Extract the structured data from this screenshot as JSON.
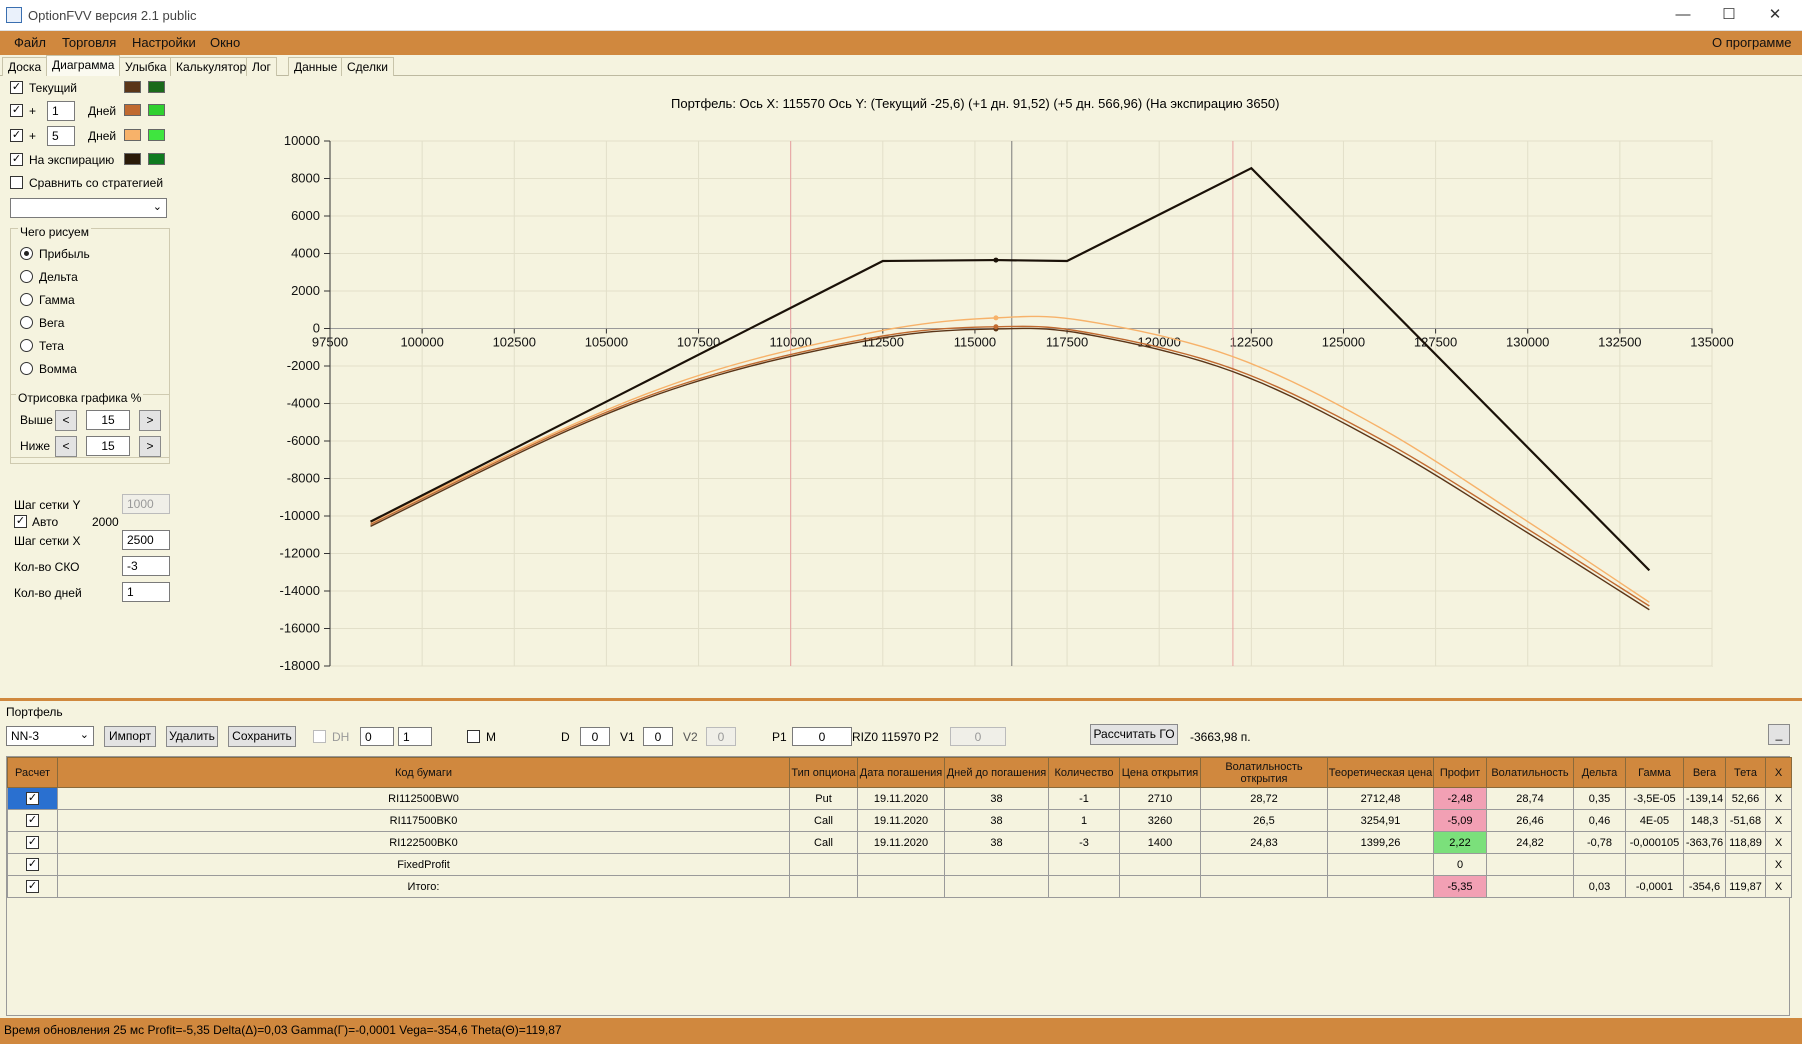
{
  "window": {
    "title": "OptionFVV версия 2.1 public",
    "minimize": "—",
    "maximize": "☐",
    "close": "✕"
  },
  "menu": {
    "items": [
      "Файл",
      "Торговля",
      "Настройки",
      "Окно"
    ],
    "about": "О программе"
  },
  "tabs": [
    "Доска",
    "Диаграмма",
    "Улыбка",
    "Калькулятор",
    "Лог",
    "Данные",
    "Сделки"
  ],
  "active_tab": "Диаграмма",
  "left_panel": {
    "current_label": "Текущий",
    "plus1_sign": "+",
    "plus1_value": "1",
    "plus1_unit": "Дней",
    "plus5_sign": "+",
    "plus5_value": "5",
    "plus5_unit": "Дней",
    "expiry_label": "На экспирацию",
    "compare_label": "Сравнить со стратегией",
    "colors": {
      "current": [
        "#5a3518",
        "#1a6a1a"
      ],
      "plus1": [
        "#c06a30",
        "#2fd02f"
      ],
      "plus5": [
        "#f7b26a",
        "#3fe53f"
      ],
      "expiry": [
        "#2a1a08",
        "#0f7a1f"
      ]
    },
    "draw_group_title": "Чего рисуем",
    "draw_options": [
      "Прибыль",
      "Дельта",
      "Гамма",
      "Вега",
      "Тета",
      "Вомма"
    ],
    "draw_selected": "Прибыль",
    "render_group_title": "Отрисовка графика %",
    "above_label": "Выше",
    "above_value": "15",
    "below_label": "Ниже",
    "below_value": "15",
    "dec": "<",
    "inc": ">",
    "grid_y_label": "Шаг сетки Y",
    "grid_y_value": "1000",
    "auto_label": "Авто",
    "auto_value": "2000",
    "grid_x_label": "Шаг сетки X",
    "grid_x_value": "2500",
    "sko_label": "Кол-во СКО",
    "sko_value": "-3",
    "days_label": "Кол-во дней",
    "days_value": "1"
  },
  "chart_title": "Портфель: Ось X: 115570 Ось Y:  (Текущий -25,6)  (+1 дн. 91,52)  (+5 дн. 566,96)  (На экспирацию 3650)",
  "chart_data": {
    "type": "line",
    "title": "Портфель: Ось X: 115570 Ось Y:  (Текущий -25,6)  (+1 дн. 91,52)  (+5 дн. 566,96)  (На экспирацию 3650)",
    "xlim": [
      97500,
      135000
    ],
    "ylim": [
      -18000,
      10000
    ],
    "x_ticks": [
      "97500",
      "100000",
      "102500",
      "105000",
      "107500",
      "110000",
      "112500",
      "115000",
      "117500",
      "120000",
      "122500",
      "125000",
      "127500",
      "130000",
      "132500",
      "135000"
    ],
    "y_ticks": [
      "10000",
      "8000",
      "6000",
      "4000",
      "2000",
      "0",
      "-2000",
      "-4000",
      "-6000",
      "-8000",
      "-10000",
      "-12000",
      "-14000",
      "-16000",
      "-18000"
    ],
    "current_x": 115570,
    "cursor_x": 116000,
    "vlines": [
      110000,
      122000
    ],
    "series": [
      {
        "color": "#1a1108",
        "x": [
          98600,
          112500,
          115570,
          117500,
          122500,
          133300
        ],
        "y": [
          -10300,
          3600,
          3650,
          3600,
          8550,
          -12900
        ]
      },
      {
        "color": "#5a3518",
        "x": [
          98600,
          104000,
          108000,
          112500,
          115570,
          118000,
          122000,
          126000,
          130000,
          133300
        ],
        "y": [
          -10550,
          -5400,
          -2500,
          -500,
          -25.6,
          -300,
          -2300,
          -6100,
          -10900,
          -15000
        ]
      },
      {
        "color": "#c06a30",
        "x": [
          98600,
          104000,
          108000,
          112500,
          115570,
          118000,
          122000,
          126000,
          130000,
          133300
        ],
        "y": [
          -10450,
          -5300,
          -2400,
          -400,
          91.52,
          -200,
          -2150,
          -5900,
          -10700,
          -14800
        ]
      },
      {
        "color": "#f7b26a",
        "x": [
          98600,
          104000,
          108000,
          112500,
          115570,
          118000,
          122000,
          126000,
          130000,
          133300
        ],
        "y": [
          -10350,
          -5200,
          -2200,
          -100,
          566.96,
          400,
          -1500,
          -5300,
          -10300,
          -14600
        ]
      }
    ]
  },
  "portfolio": {
    "label": "Портфель",
    "select_value": "NN-3",
    "import": "Импорт",
    "delete": "Удалить",
    "save": "Сохранить",
    "dh_label": "DH",
    "num1": "0",
    "num2": "1",
    "m_label": "M",
    "d_label": "D",
    "d_value": "0",
    "v1_label": "V1",
    "v1_value": "0",
    "v2_label": "V2",
    "v2_value": "0",
    "p1_label": "P1",
    "p1_value": "0",
    "riz_label": "RIZ0 115970",
    "p2_label": "P2",
    "p2_value": "0",
    "calc_go": "Рассчитать ГО",
    "go_value": "-3663,98 п.",
    "collapse": "_"
  },
  "table": {
    "headers": [
      "Расчет",
      "Код бумаги",
      "Тип опциона",
      "Дата погашения",
      "Дней до погашения",
      "Количество",
      "Цена открытия",
      "Волатильность открытия",
      "Теоретическая цена",
      "Профит",
      "Волатильность",
      "Дельта",
      "Гамма",
      "Вега",
      "Тета",
      "X"
    ],
    "rows": [
      [
        "RI112500BW0",
        "Put",
        "19.11.2020",
        "38",
        "-1",
        "2710",
        "28,72",
        "2712,48",
        "-2,48",
        "28,74",
        "0,35",
        "-3,5E-05",
        "-139,14",
        "52,66",
        "X"
      ],
      [
        "RI117500BK0",
        "Call",
        "19.11.2020",
        "38",
        "1",
        "3260",
        "26,5",
        "3254,91",
        "-5,09",
        "26,46",
        "0,46",
        "4E-05",
        "148,3",
        "-51,68",
        "X"
      ],
      [
        "RI122500BK0",
        "Call",
        "19.11.2020",
        "38",
        "-3",
        "1400",
        "24,83",
        "1399,26",
        "2,22",
        "24,82",
        "-0,78",
        "-0,000105",
        "-363,76",
        "118,89",
        "X"
      ],
      [
        "FixedProfit",
        "",
        "",
        "",
        "",
        "",
        "",
        "",
        "0",
        "",
        "",
        "",
        "",
        "",
        "X"
      ],
      [
        "Итого:",
        "",
        "",
        "",
        "",
        "",
        "",
        "",
        "-5,35",
        "",
        "0,03",
        "-0,0001",
        "-354,6",
        "119,87",
        "X"
      ]
    ],
    "profit_colors": [
      "#f2a0b4",
      "#f2a0b4",
      "#7be07b",
      "",
      "#f2a0b4"
    ]
  },
  "status": "Время обновления 25 мс  Profit=-5,35 Delta(Δ)=0,03 Gamma(Γ)=-0,0001 Vega=-354,6 Theta(Θ)=119,87"
}
